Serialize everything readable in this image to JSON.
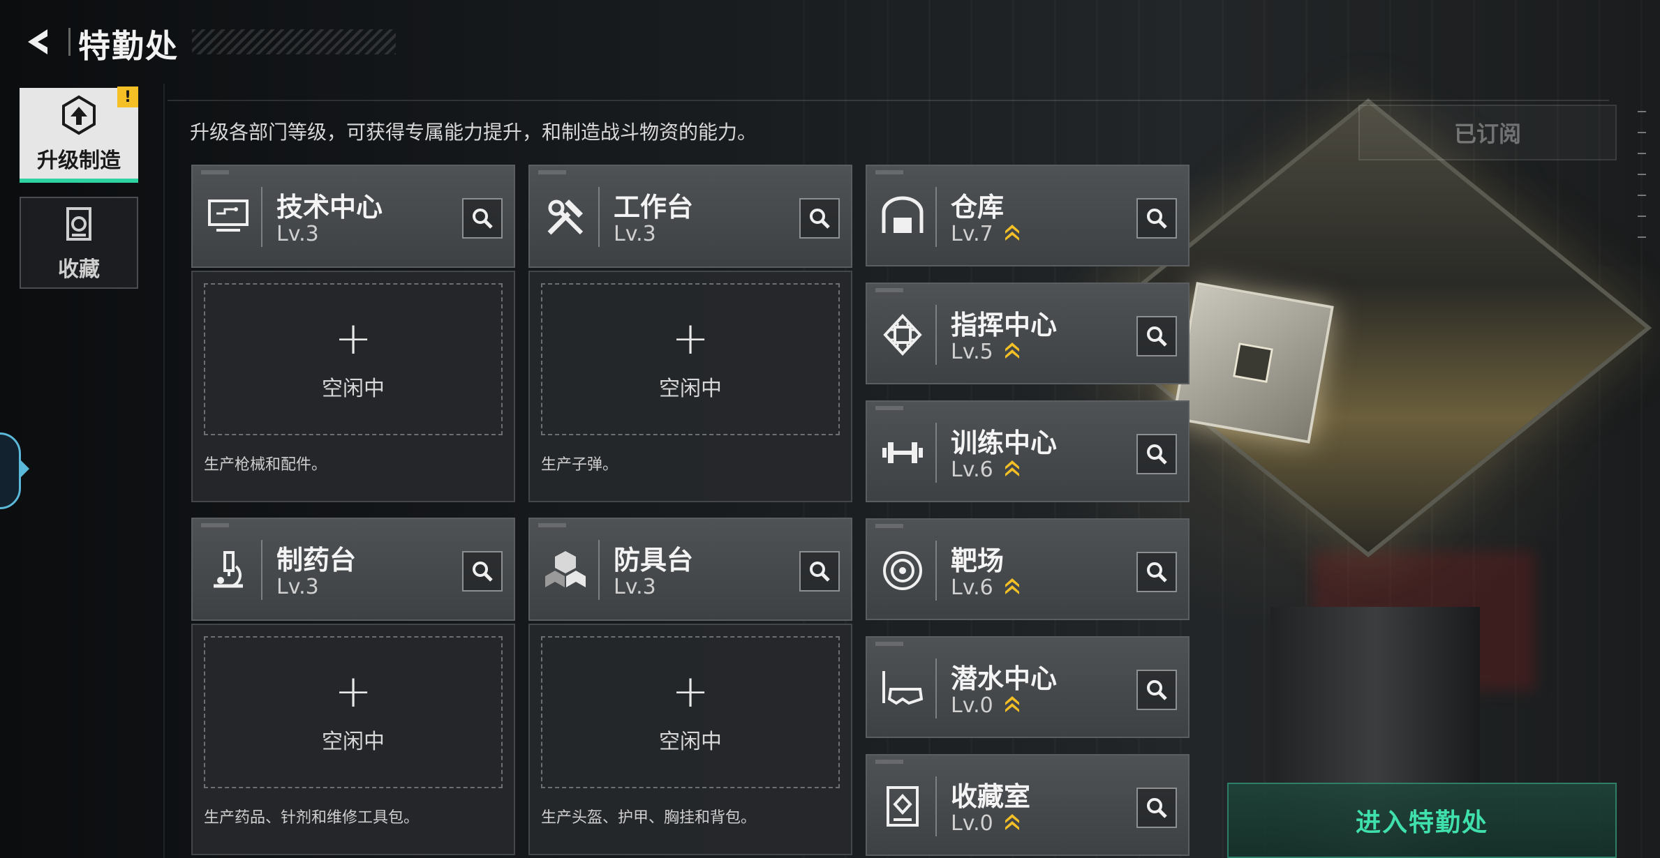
{
  "header": {
    "title": "特勤处",
    "back_icon": "back-arrow-icon"
  },
  "sidebar": {
    "items": [
      {
        "label": "升级制造",
        "icon": "upgrade-craft-icon",
        "active": true,
        "badge": "!"
      },
      {
        "label": "收藏",
        "icon": "collection-icon",
        "active": false
      }
    ]
  },
  "description": "升级各部门等级，可获得专属能力提升，和制造战斗物资的能力。",
  "subscribe_label": "已订阅",
  "enter_label": "进入特勤处",
  "production_stations": [
    {
      "name": "技术中心",
      "level": "Lv.3",
      "icon": "monitor-icon",
      "slot_plus": "+",
      "slot_status": "空闲中",
      "desc": "生产枪械和配件。"
    },
    {
      "name": "工作台",
      "level": "Lv.3",
      "icon": "tools-icon",
      "slot_plus": "+",
      "slot_status": "空闲中",
      "desc": "生产子弹。"
    },
    {
      "name": "制药台",
      "level": "Lv.3",
      "icon": "microscope-icon",
      "slot_plus": "+",
      "slot_status": "空闲中",
      "desc": "生产药品、针剂和维修工具包。"
    },
    {
      "name": "防具台",
      "level": "Lv.3",
      "icon": "armor-cubes-icon",
      "slot_plus": "+",
      "slot_status": "空闲中",
      "desc": "生产头盔、护甲、胸挂和背包。"
    }
  ],
  "facilities": [
    {
      "name": "仓库",
      "level": "Lv.7",
      "icon": "warehouse-icon",
      "upgradable": true
    },
    {
      "name": "指挥中心",
      "level": "Lv.5",
      "icon": "chip-icon",
      "upgradable": true
    },
    {
      "name": "训练中心",
      "level": "Lv.6",
      "icon": "dumbbell-icon",
      "upgradable": true
    },
    {
      "name": "靶场",
      "level": "Lv.6",
      "icon": "target-icon",
      "upgradable": true
    },
    {
      "name": "潜水中心",
      "level": "Lv.0",
      "icon": "diving-mask-icon",
      "upgradable": true
    },
    {
      "name": "收藏室",
      "level": "Lv.0",
      "icon": "collection-room-icon",
      "upgradable": true
    }
  ],
  "colors": {
    "accent_green": "#3fe0ac",
    "upgrade_gold": "#f4c026",
    "card_bg": "#3e4144"
  }
}
